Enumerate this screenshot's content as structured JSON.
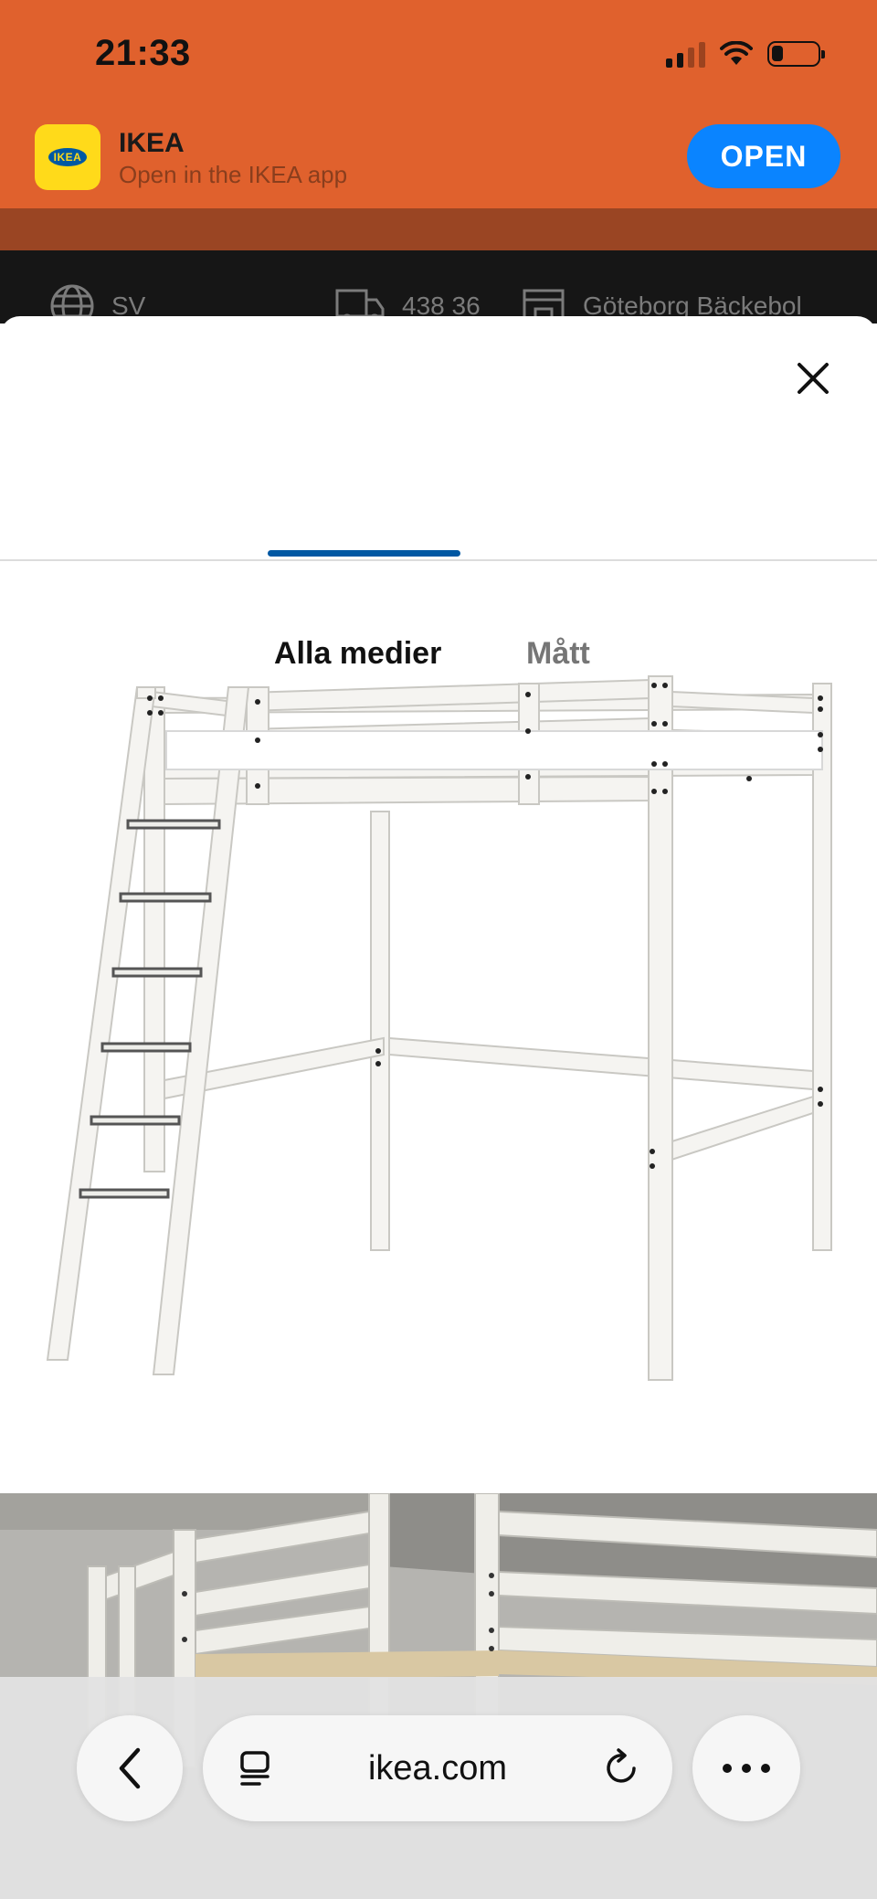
{
  "status_bar": {
    "time": "21:33"
  },
  "app_banner": {
    "app_name": "IKEA",
    "subtitle": "Open in the IKEA app",
    "logo_text": "IKEA",
    "open_label": "OPEN"
  },
  "background_page": {
    "language": "SV",
    "postal_code": "438 36",
    "store": "Göteborg Bäckebol"
  },
  "sheet": {
    "tabs": [
      {
        "label": "Alla medier",
        "active": true
      },
      {
        "label": "Mått",
        "active": false
      }
    ]
  },
  "browser": {
    "url": "ikea.com"
  },
  "colors": {
    "banner": "#e0612d",
    "accent_blue": "#0058a3",
    "open_button": "#0a84ff"
  },
  "icons": [
    "globe-icon",
    "truck-icon",
    "store-icon",
    "close-icon",
    "back-chevron-icon",
    "reader-icon",
    "reload-icon",
    "more-icon"
  ]
}
